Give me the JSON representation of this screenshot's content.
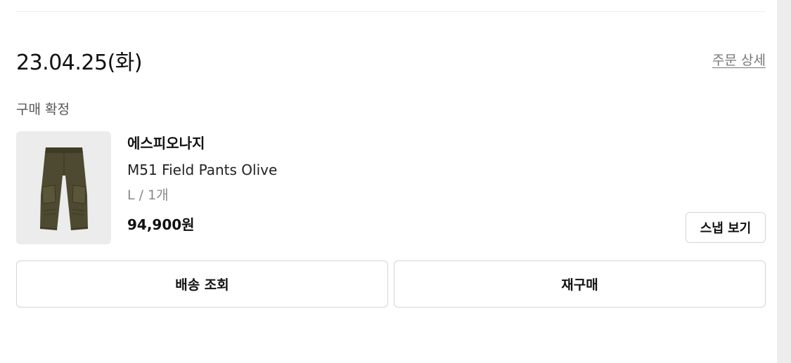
{
  "order": {
    "date": "23.04.25(화)",
    "detail_link": "주문 상세",
    "status": "구매 확정"
  },
  "product": {
    "image_icon": "olive-cargo-pants-image",
    "brand": "에스피오나지",
    "name": "M51 Field Pants Olive",
    "option": "L / 1개",
    "price": "94,900원"
  },
  "buttons": {
    "snap": "스냅 보기",
    "track_delivery": "배송 조회",
    "rebuy": "재구매"
  },
  "colors": {
    "product_olive": "#4e4a31",
    "border": "#d5d5d5",
    "link_gray": "#777777"
  }
}
